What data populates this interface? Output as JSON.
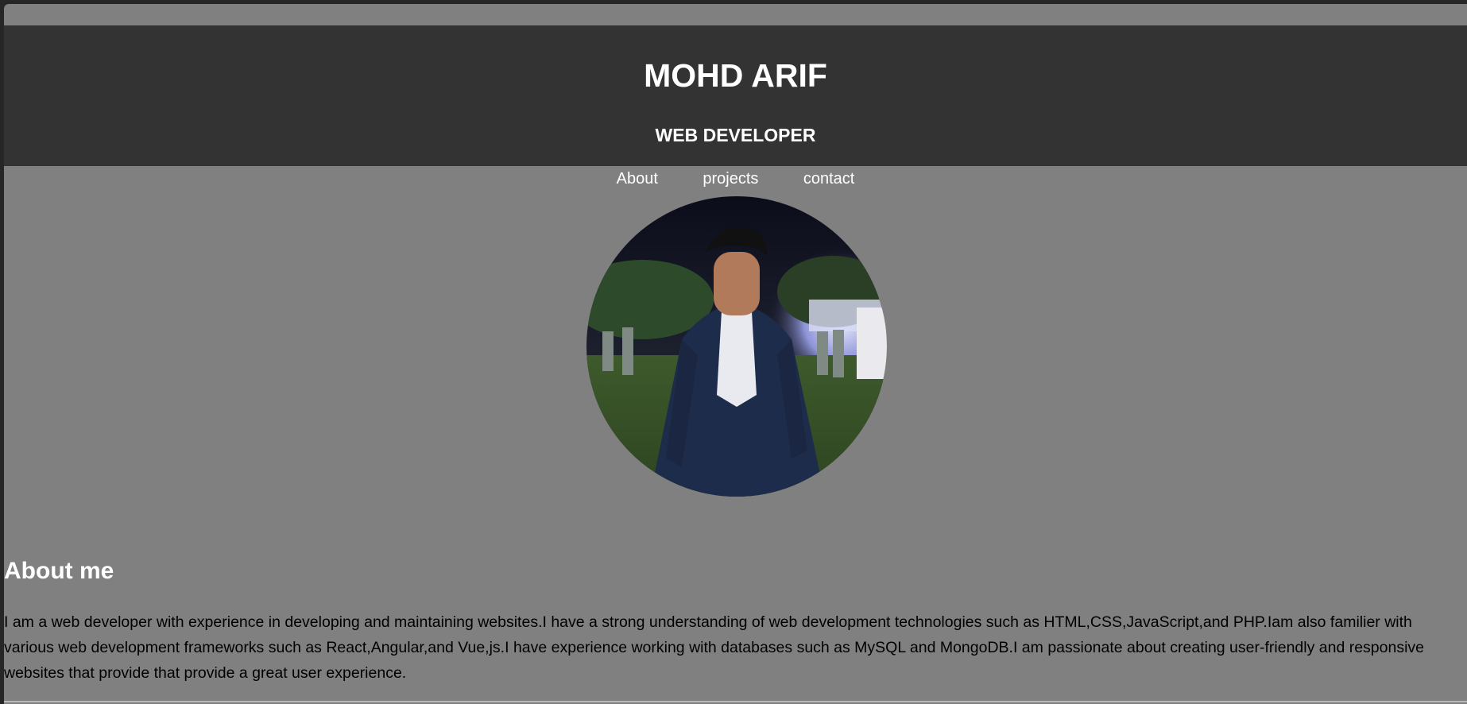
{
  "header": {
    "title": "MOHD ARIF",
    "subtitle": "WEB DEVELOPER"
  },
  "nav": {
    "items": [
      {
        "label": "About"
      },
      {
        "label": "projects"
      },
      {
        "label": "contact"
      }
    ]
  },
  "profile": {
    "image_alt": "profile photo"
  },
  "about": {
    "heading": "About me",
    "text": "I am a web developer with experience in developing and maintaining websites.I have a strong understanding of web development technologies such as HTML,CSS,JavaScript,and PHP.Iam also familier with various web development frameworks such as React,Angular,and Vue,js.I have experience working with databases such as MySQL and MongoDB.I am passionate about creating user-friendly and responsive websites that provide that provide a great user experience."
  },
  "colors": {
    "page_background": "#808080",
    "header_background": "#333333",
    "header_text": "#ffffff",
    "body_text": "#000000"
  }
}
